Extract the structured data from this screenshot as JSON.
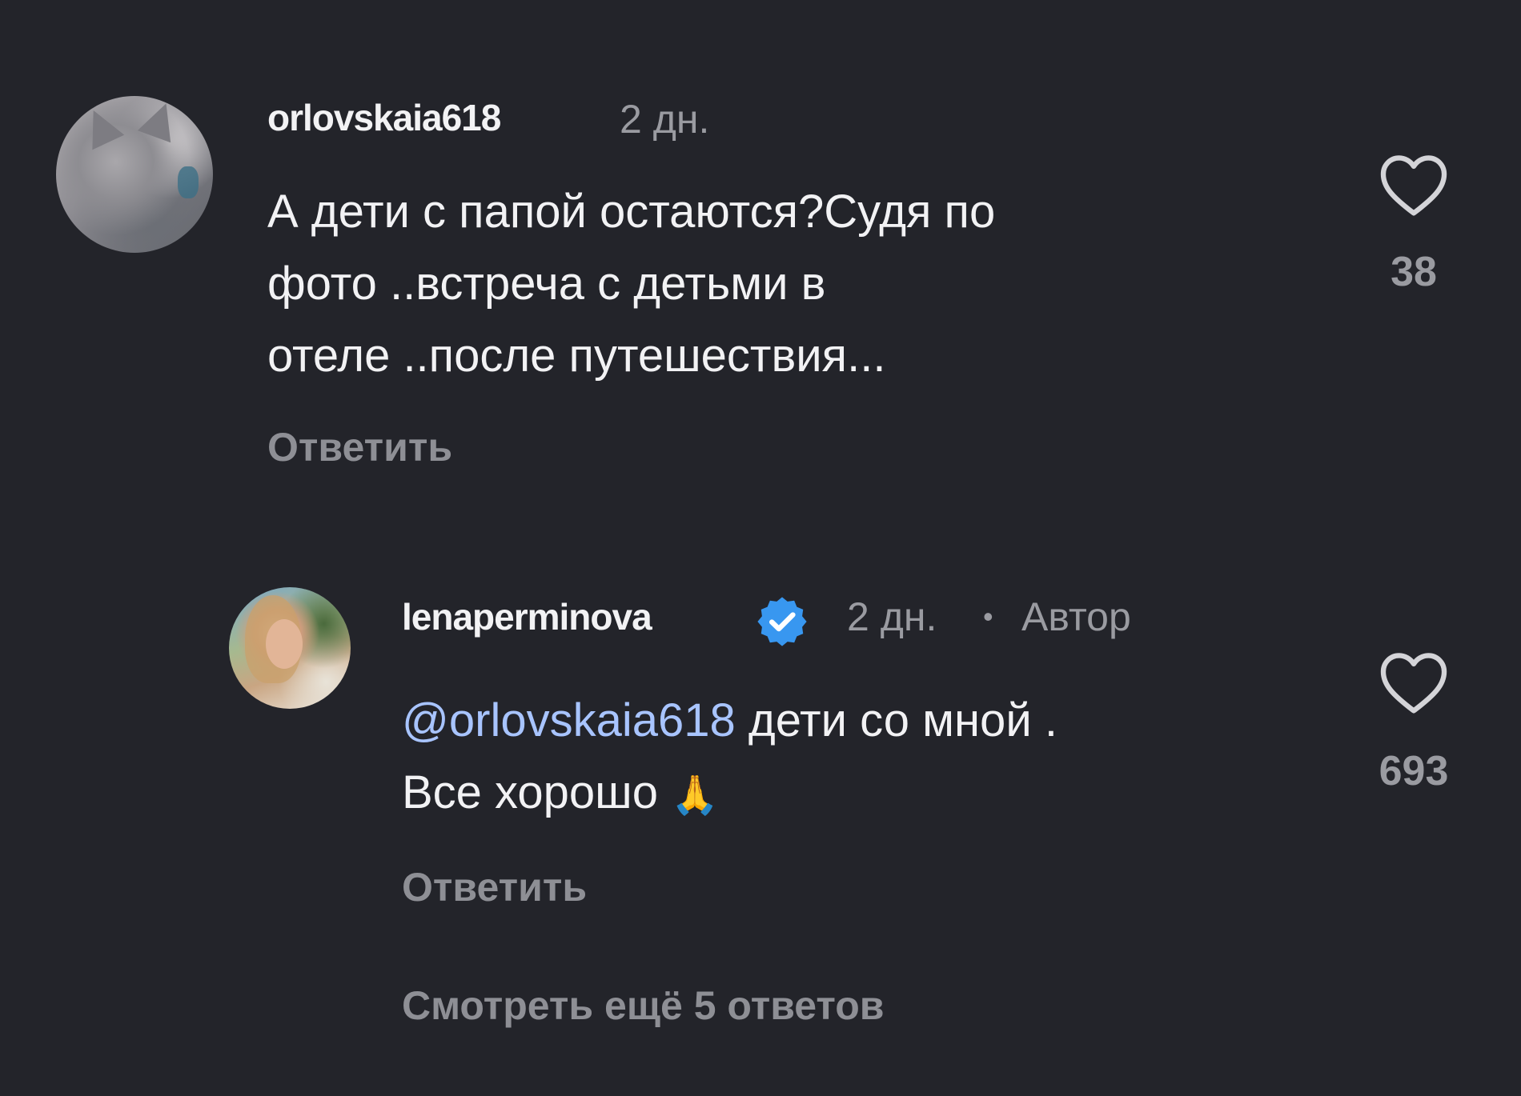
{
  "comments": [
    {
      "username": "orlovskaia618",
      "time": "2 дн.",
      "line1": "А дети с папой остаются?Судя по",
      "line2": "фото ..встреча с детьми в",
      "line3": "отеле ..после путешествия...",
      "reply_label": "Ответить",
      "likes": "38",
      "avatar_icon": "cat-avatar"
    }
  ],
  "reply": {
    "username": "lenaperminova",
    "verified_icon": "verified-badge-icon",
    "time": "2 дн.",
    "separator": "•",
    "author_label": "Автор",
    "mention": "@orlovskaia618",
    "line1_rest": " дети со мной .",
    "line2": "Все хорошо",
    "emoji": "🙏",
    "reply_label": "Ответить",
    "likes": "693",
    "avatar_icon": "woman-avatar"
  },
  "more_replies_label": "Смотреть ещё 5 ответов",
  "colors": {
    "background": "#23242a",
    "text": "#f2f2f4",
    "muted": "#9a9ba1",
    "mention": "#a8c4ff",
    "verified": "#3897f0"
  }
}
